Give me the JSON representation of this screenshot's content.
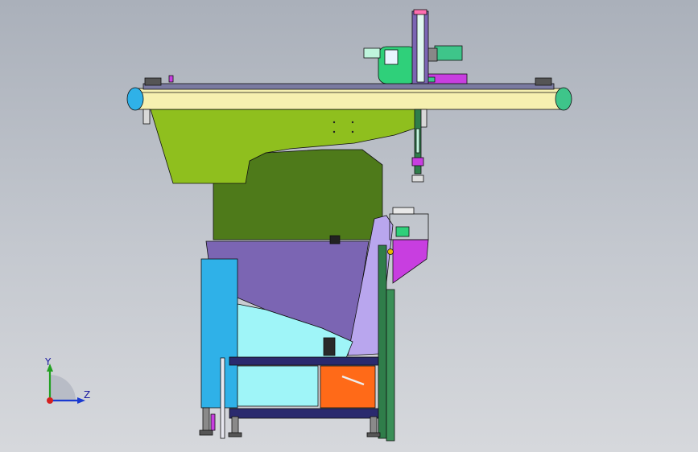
{
  "scene": {
    "colors": {
      "background_top": "#aab0ba",
      "background_bottom": "#d6d8dc",
      "beam": "#f6f0b0",
      "hopper_green": "#8fbf1e",
      "body_dark_green": "#4e7a1a",
      "purple_chute": "#7b65b3",
      "lavender": "#b9a6ee",
      "cyan_panel": "#2fb1e8",
      "light_cyan": "#9ff5f8",
      "magenta": "#c83ee0",
      "orange": "#ff6a18",
      "rail_green": "#2f7d4a",
      "frame_navy": "#2a2a6e",
      "edge_black": "#111111"
    }
  },
  "triad": {
    "y_label": "Y",
    "z_label": "Z"
  }
}
